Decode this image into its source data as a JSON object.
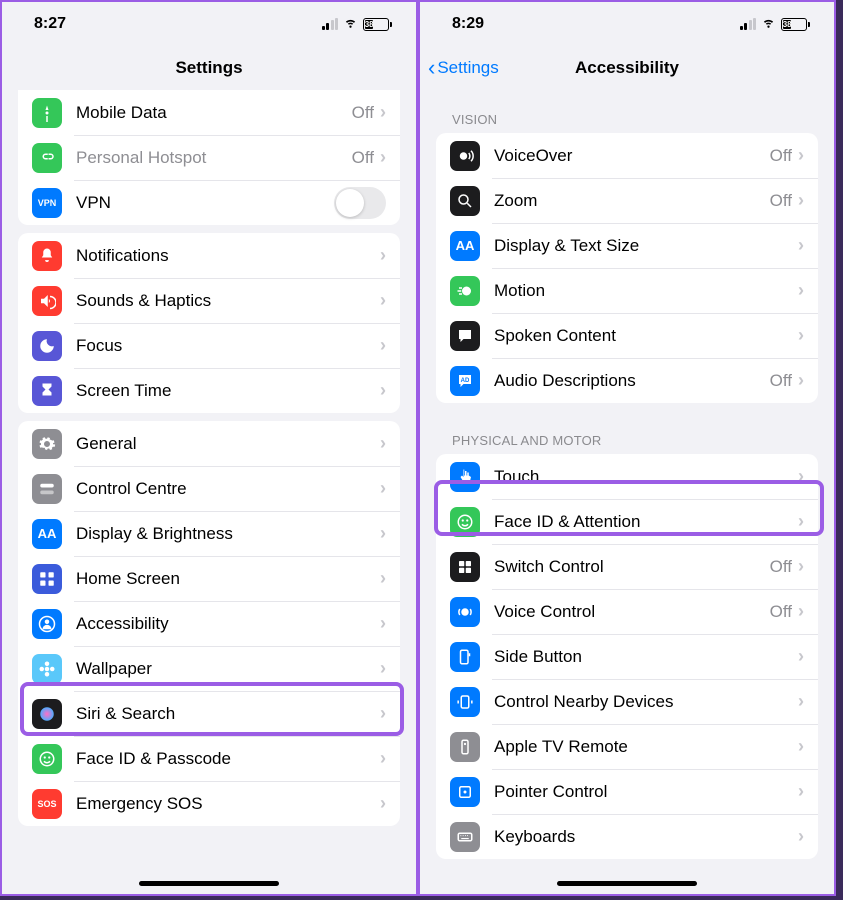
{
  "left": {
    "time": "8:27",
    "battery": "38",
    "title": "Settings",
    "g1": [
      {
        "label": "Mobile Data",
        "value": "Off",
        "chevron": true,
        "iconBg": "#34c759",
        "icon": "antenna"
      },
      {
        "label": "Personal Hotspot",
        "value": "Off",
        "chevron": true,
        "disabled": true,
        "iconBg": "#34c759",
        "icon": "link"
      },
      {
        "label": "VPN",
        "switch": true,
        "iconBg": "#007aff",
        "iconText": "VPN"
      }
    ],
    "g2": [
      {
        "label": "Notifications",
        "chevron": true,
        "iconBg": "#ff3b30",
        "icon": "bell"
      },
      {
        "label": "Sounds & Haptics",
        "chevron": true,
        "iconBg": "#ff3b30",
        "icon": "speaker"
      },
      {
        "label": "Focus",
        "chevron": true,
        "iconBg": "#5856d6",
        "icon": "moon"
      },
      {
        "label": "Screen Time",
        "chevron": true,
        "iconBg": "#5856d6",
        "icon": "hourglass"
      }
    ],
    "g3": [
      {
        "label": "General",
        "chevron": true,
        "iconBg": "#8e8e93",
        "icon": "gear"
      },
      {
        "label": "Control Centre",
        "chevron": true,
        "iconBg": "#8e8e93",
        "icon": "switches"
      },
      {
        "label": "Display & Brightness",
        "chevron": true,
        "iconBg": "#007aff",
        "iconText": "AA"
      },
      {
        "label": "Home Screen",
        "chevron": true,
        "iconBg": "#3b5bdb",
        "icon": "grid"
      },
      {
        "label": "Accessibility",
        "chevron": true,
        "iconBg": "#007aff",
        "icon": "person-circle"
      },
      {
        "label": "Wallpaper",
        "chevron": true,
        "iconBg": "#5ac8fa",
        "icon": "flower"
      },
      {
        "label": "Siri & Search",
        "chevron": true,
        "iconBg": "#1c1c1e",
        "icon": "siri"
      },
      {
        "label": "Face ID & Passcode",
        "chevron": true,
        "iconBg": "#34c759",
        "icon": "face"
      },
      {
        "label": "Emergency SOS",
        "chevron": true,
        "iconBg": "#ff3b30",
        "iconText": "SOS"
      }
    ]
  },
  "right": {
    "time": "8:29",
    "battery": "38",
    "back": "Settings",
    "title": "Accessibility",
    "h1": "Vision",
    "g1": [
      {
        "label": "VoiceOver",
        "value": "Off",
        "chevron": true,
        "iconBg": "#1c1c1e",
        "icon": "voiceover"
      },
      {
        "label": "Zoom",
        "value": "Off",
        "chevron": true,
        "iconBg": "#1c1c1e",
        "icon": "zoom"
      },
      {
        "label": "Display & Text Size",
        "chevron": true,
        "iconBg": "#007aff",
        "iconText": "AA"
      },
      {
        "label": "Motion",
        "chevron": true,
        "iconBg": "#34c759",
        "icon": "motion"
      },
      {
        "label": "Spoken Content",
        "chevron": true,
        "iconBg": "#1c1c1e",
        "icon": "bubble"
      },
      {
        "label": "Audio Descriptions",
        "value": "Off",
        "chevron": true,
        "iconBg": "#007aff",
        "icon": "ad"
      }
    ],
    "h2": "Physical and Motor",
    "g2": [
      {
        "label": "Touch",
        "chevron": true,
        "iconBg": "#007aff",
        "icon": "touch"
      },
      {
        "label": "Face ID & Attention",
        "chevron": true,
        "iconBg": "#34c759",
        "icon": "face"
      },
      {
        "label": "Switch Control",
        "value": "Off",
        "chevron": true,
        "iconBg": "#1c1c1e",
        "icon": "grid4"
      },
      {
        "label": "Voice Control",
        "value": "Off",
        "chevron": true,
        "iconBg": "#007aff",
        "icon": "voice"
      },
      {
        "label": "Side Button",
        "chevron": true,
        "iconBg": "#007aff",
        "icon": "sidebutton"
      },
      {
        "label": "Control Nearby Devices",
        "chevron": true,
        "iconBg": "#007aff",
        "icon": "nearby"
      },
      {
        "label": "Apple TV Remote",
        "chevron": true,
        "iconBg": "#8e8e93",
        "icon": "remote"
      },
      {
        "label": "Pointer Control",
        "chevron": true,
        "iconBg": "#007aff",
        "icon": "pointer"
      },
      {
        "label": "Keyboards",
        "chevron": true,
        "iconBg": "#8e8e93",
        "icon": "keyboard"
      }
    ]
  }
}
